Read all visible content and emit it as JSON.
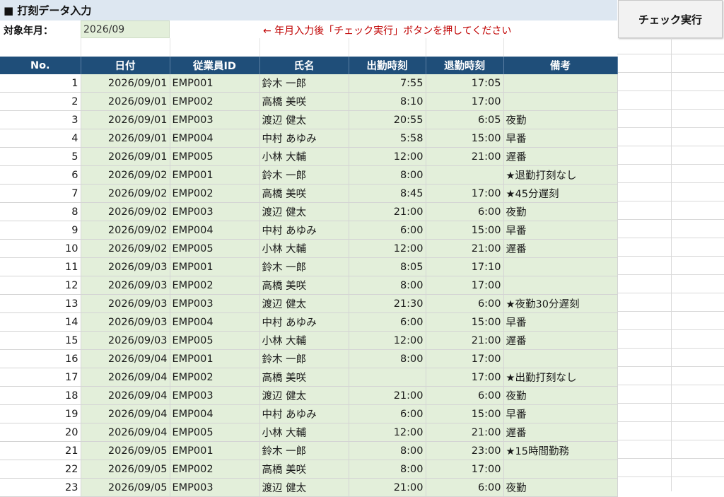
{
  "sheet": {
    "title": "■ 打刻データ入力",
    "target_label": "対象年月：",
    "target_value": "2026/09",
    "instruction": "← 年月入力後「チェック実行」ボタンを押してください",
    "check_button": "チェック実行"
  },
  "table": {
    "headers": [
      "No.",
      "日付",
      "従業員ID",
      "氏名",
      "出勤時刻",
      "退勤時刻",
      "備考"
    ],
    "rows": [
      [
        "1",
        "2026/09/01",
        "EMP001",
        "鈴木 一郎",
        "7:55",
        "17:05",
        ""
      ],
      [
        "2",
        "2026/09/01",
        "EMP002",
        "高橋 美咲",
        "8:10",
        "17:00",
        ""
      ],
      [
        "3",
        "2026/09/01",
        "EMP003",
        "渡辺 健太",
        "20:55",
        "6:05",
        "夜勤"
      ],
      [
        "4",
        "2026/09/01",
        "EMP004",
        "中村 あゆみ",
        "5:58",
        "15:00",
        "早番"
      ],
      [
        "5",
        "2026/09/01",
        "EMP005",
        "小林 大輔",
        "12:00",
        "21:00",
        "遅番"
      ],
      [
        "6",
        "2026/09/02",
        "EMP001",
        "鈴木 一郎",
        "8:00",
        "",
        "★退勤打刻なし"
      ],
      [
        "7",
        "2026/09/02",
        "EMP002",
        "高橋 美咲",
        "8:45",
        "17:00",
        "★45分遅刻"
      ],
      [
        "8",
        "2026/09/02",
        "EMP003",
        "渡辺 健太",
        "21:00",
        "6:00",
        "夜勤"
      ],
      [
        "9",
        "2026/09/02",
        "EMP004",
        "中村 あゆみ",
        "6:00",
        "15:00",
        "早番"
      ],
      [
        "10",
        "2026/09/02",
        "EMP005",
        "小林 大輔",
        "12:00",
        "21:00",
        "遅番"
      ],
      [
        "11",
        "2026/09/03",
        "EMP001",
        "鈴木 一郎",
        "8:05",
        "17:10",
        ""
      ],
      [
        "12",
        "2026/09/03",
        "EMP002",
        "高橋 美咲",
        "8:00",
        "17:00",
        ""
      ],
      [
        "13",
        "2026/09/03",
        "EMP003",
        "渡辺 健太",
        "21:30",
        "6:00",
        "★夜勤30分遅刻"
      ],
      [
        "14",
        "2026/09/03",
        "EMP004",
        "中村 あゆみ",
        "6:00",
        "15:00",
        "早番"
      ],
      [
        "15",
        "2026/09/03",
        "EMP005",
        "小林 大輔",
        "12:00",
        "21:00",
        "遅番"
      ],
      [
        "16",
        "2026/09/04",
        "EMP001",
        "鈴木 一郎",
        "8:00",
        "17:00",
        ""
      ],
      [
        "17",
        "2026/09/04",
        "EMP002",
        "高橋 美咲",
        "",
        "17:00",
        "★出勤打刻なし"
      ],
      [
        "18",
        "2026/09/04",
        "EMP003",
        "渡辺 健太",
        "21:00",
        "6:00",
        "夜勤"
      ],
      [
        "19",
        "2026/09/04",
        "EMP004",
        "中村 あゆみ",
        "6:00",
        "15:00",
        "早番"
      ],
      [
        "20",
        "2026/09/04",
        "EMP005",
        "小林 大輔",
        "12:00",
        "21:00",
        "遅番"
      ],
      [
        "21",
        "2026/09/05",
        "EMP001",
        "鈴木 一郎",
        "8:00",
        "23:00",
        "★15時間勤務"
      ],
      [
        "22",
        "2026/09/05",
        "EMP002",
        "高橋 美咲",
        "8:00",
        "17:00",
        ""
      ],
      [
        "23",
        "2026/09/05",
        "EMP003",
        "渡辺 健太",
        "21:00",
        "6:00",
        "夜勤"
      ]
    ]
  }
}
